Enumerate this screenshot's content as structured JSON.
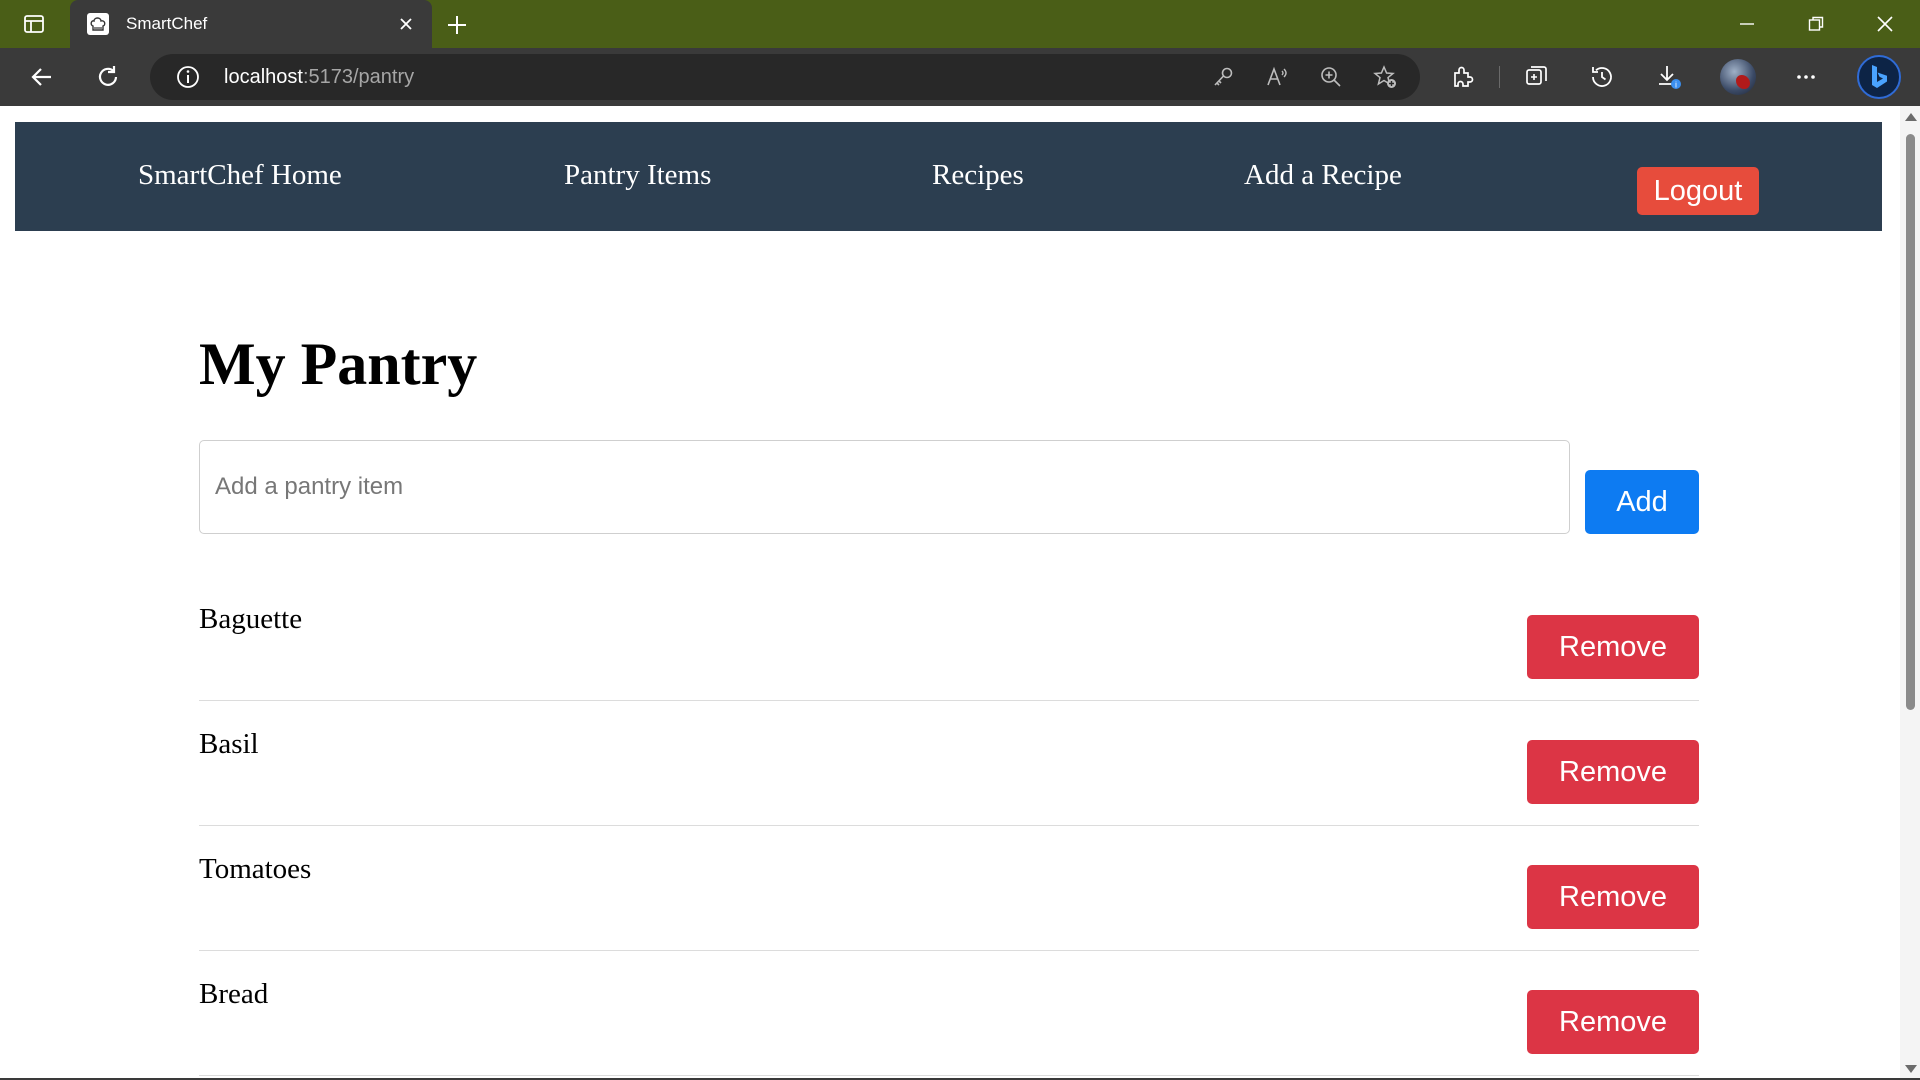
{
  "browser": {
    "tab_title": "SmartChef",
    "url_host": "localhost",
    "url_path": ":5173/pantry",
    "accent": "#4a5e17"
  },
  "nav": {
    "links": [
      "SmartChef Home",
      "Pantry Items",
      "Recipes",
      "Add a Recipe"
    ],
    "logout_label": "Logout",
    "background": "#2c3e50",
    "logout_color": "#e74c3c"
  },
  "main": {
    "title": "My Pantry",
    "input_placeholder": "Add a pantry item",
    "input_value": "",
    "add_label": "Add",
    "add_color": "#0d7bf2",
    "items": [
      {
        "name": "Baguette",
        "remove_label": "Remove"
      },
      {
        "name": "Basil",
        "remove_label": "Remove"
      },
      {
        "name": "Tomatoes",
        "remove_label": "Remove"
      },
      {
        "name": "Bread",
        "remove_label": "Remove"
      }
    ],
    "remove_color": "#dc3545"
  },
  "icons": {
    "titlebar": [
      "sidebar-toggle-icon",
      "chef-hat-favicon-icon",
      "close-icon",
      "plus-icon",
      "minimize-icon",
      "restore-icon",
      "close-window-icon"
    ],
    "toolbar": [
      "back-arrow-icon",
      "refresh-icon",
      "info-icon",
      "key-icon",
      "read-aloud-icon",
      "zoom-icon",
      "favorite-add-icon",
      "extensions-icon",
      "collections-icon",
      "history-icon",
      "downloads-icon",
      "profile-avatar",
      "more-icon",
      "bing-icon"
    ]
  }
}
